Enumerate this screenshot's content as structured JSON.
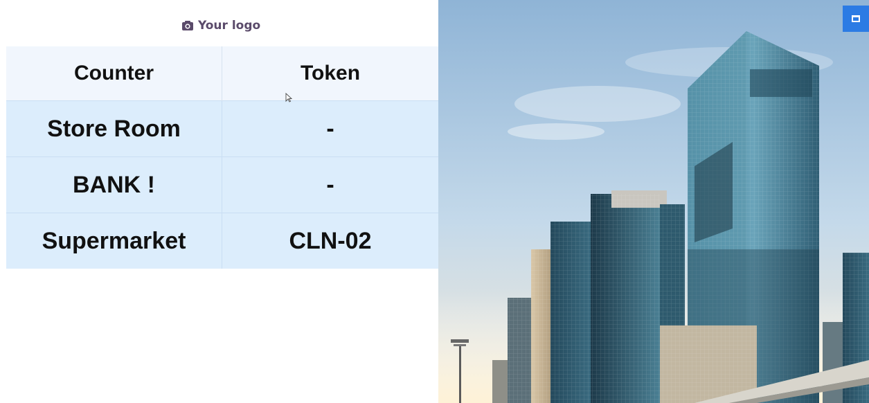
{
  "logo": {
    "text": "Your logo",
    "icon": "camera-icon",
    "color": "#5a4a6a"
  },
  "table": {
    "headers": [
      "Counter",
      "Token"
    ],
    "rows": [
      {
        "counter": "Store Room",
        "token": "-"
      },
      {
        "counter": "BANK !",
        "token": "-"
      },
      {
        "counter": "Supermarket",
        "token": "CLN-02"
      }
    ]
  },
  "colors": {
    "header_bg": "#f1f6fd",
    "row_bg": "#dcedfc",
    "accent": "#2b7be4"
  },
  "right_panel": {
    "image_subject": "city-skyscrapers-image",
    "maximize_icon": "maximize-icon"
  }
}
